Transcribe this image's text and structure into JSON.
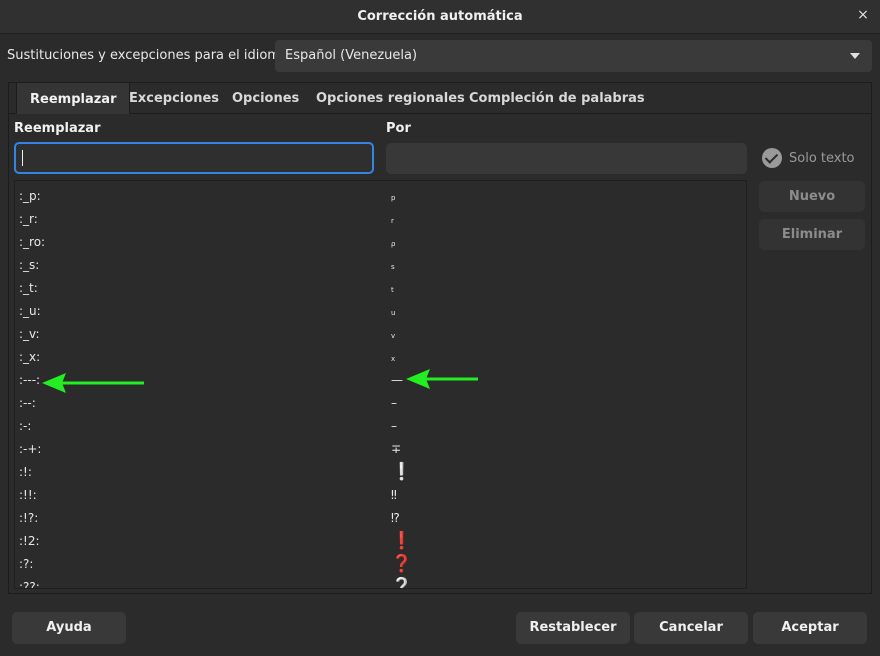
{
  "window": {
    "title": "Corrección automática",
    "close_glyph": "×"
  },
  "language": {
    "label": "Sustituciones y excepciones para el idioma:",
    "value": "Español (Venezuela)"
  },
  "tabs": [
    {
      "label": "Reemplazar",
      "active": true
    },
    {
      "label": "Excepciones"
    },
    {
      "label": "Opciones"
    },
    {
      "label": "Opciones regionales"
    },
    {
      "label": "Compleción de palabras"
    }
  ],
  "columns": {
    "replace": "Reemplazar",
    "by": "Por"
  },
  "inputs": {
    "replace_value": "",
    "by_value": ""
  },
  "options": {
    "text_only_label": "Solo texto",
    "text_only_checked": true
  },
  "buttons": {
    "new": "Nuevo",
    "delete": "Eliminar",
    "help": "Ayuda",
    "reset": "Restablecer",
    "cancel": "Cancelar",
    "ok": "Aceptar"
  },
  "rows": [
    {
      "key": ":_p:",
      "value": "p"
    },
    {
      "key": ":_r:",
      "value": "r"
    },
    {
      "key": ":_ro:",
      "value": "ρ"
    },
    {
      "key": ":_s:",
      "value": "s"
    },
    {
      "key": ":_t:",
      "value": "t"
    },
    {
      "key": ":_u:",
      "value": "u"
    },
    {
      "key": ":_v:",
      "value": "v"
    },
    {
      "key": ":_x:",
      "value": "x"
    },
    {
      "key": ":---:",
      "value": "—"
    },
    {
      "key": ":--:",
      "value": "–"
    },
    {
      "key": ":-:",
      "value": "–"
    },
    {
      "key": ":-+:",
      "value": "∓"
    },
    {
      "key": ":!:",
      "value": "❕"
    },
    {
      "key": ":!!:",
      "value": "‼"
    },
    {
      "key": ":!?:",
      "value": "⁉"
    },
    {
      "key": ":!2:",
      "value": "❗"
    },
    {
      "key": ":?:",
      "value": "❓"
    },
    {
      "key": ":??:",
      "value": "❔"
    }
  ],
  "colors": {
    "accent": "#3584e4",
    "annotation_arrow": "#22ee22"
  }
}
